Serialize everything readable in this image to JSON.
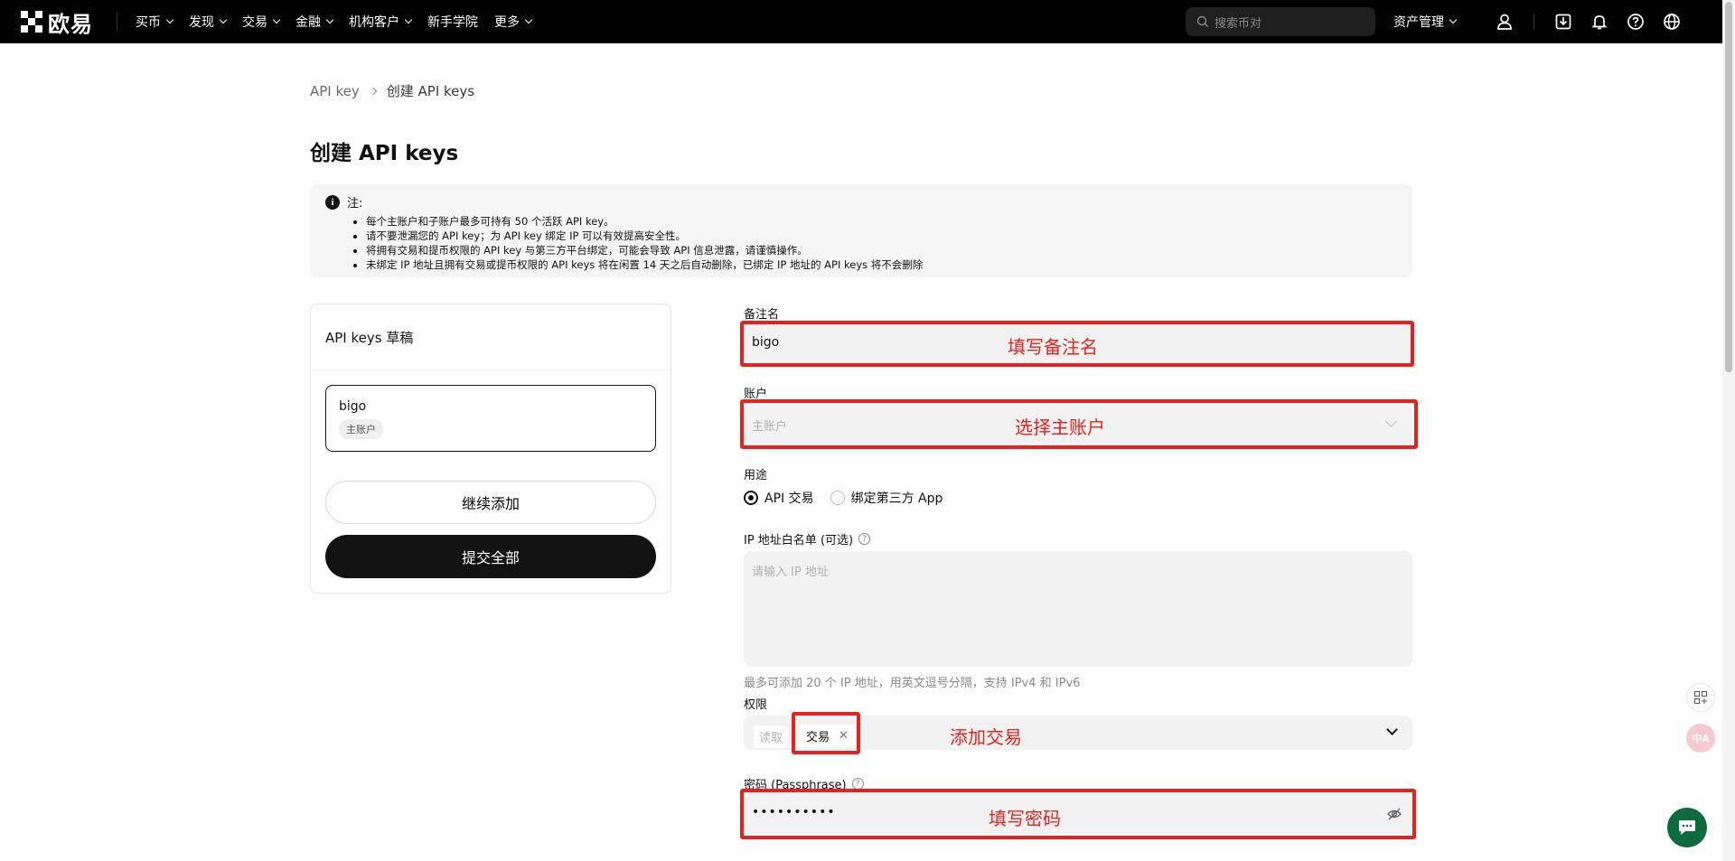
{
  "header": {
    "logo_text": "欧易",
    "nav": [
      "买币",
      "发现",
      "交易",
      "金融",
      "机构客户",
      "新手学院",
      "更多"
    ],
    "nav_has_chevron": [
      true,
      true,
      true,
      true,
      true,
      false,
      true
    ],
    "search_placeholder": "搜索币对",
    "asset_label": "资产管理"
  },
  "breadcrumb": {
    "parent": "API key",
    "current": "创建 API keys"
  },
  "page_title": "创建 API keys",
  "notice": {
    "heading": "注:",
    "items": [
      "每个主账户和子账户最多可持有 50 个活跃 API key。",
      "请不要泄漏您的 API key；为 API key 绑定 IP 可以有效提高安全性。",
      "将拥有交易和提币权限的 API key 与第三方平台绑定，可能会导致 API 信息泄露，请谨慎操作。",
      "未绑定 IP 地址且拥有交易或提币权限的 API keys 将在闲置 14 天之后自动删除，已绑定 IP 地址的 API keys 将不会删除"
    ]
  },
  "drafts": {
    "title": "API keys 草稿",
    "item_name": "bigo",
    "item_tag": "主账户",
    "continue_label": "继续添加",
    "submit_label": "提交全部"
  },
  "form": {
    "remark_label": "备注名",
    "remark_value": "bigo",
    "account_label": "账户",
    "account_placeholder": "主账户",
    "purpose_label": "用途",
    "purpose_options": [
      "API 交易",
      "绑定第三方 App"
    ],
    "purpose_selected": "API 交易",
    "ip_label": "IP 地址白名单 (可选)",
    "ip_placeholder": "请输入 IP 地址",
    "ip_hint": "最多可添加 20 个 IP 地址，用英文逗号分隔，支持 IPv4 和 IPv6",
    "perm_label": "权限",
    "perm_readonly": "读取",
    "perm_chip": "交易",
    "pass_label": "密码 (Passphrase)",
    "pass_value": "••••••••••"
  },
  "annotations": {
    "remark": "填写备注名",
    "account": "选择主账户",
    "perm": "添加交易",
    "pass": "填写密码"
  },
  "colors": {
    "annotation_red": "#e8211d",
    "header_bg": "#000000",
    "chat_green": "#0c6b3c"
  },
  "icons": [
    "search-icon",
    "user-icon",
    "download-icon",
    "bell-icon",
    "help-icon",
    "globe-icon",
    "info-icon",
    "chevron-down-icon",
    "eye-off-icon",
    "grid-icon",
    "translate-icon",
    "chat-icon"
  ]
}
